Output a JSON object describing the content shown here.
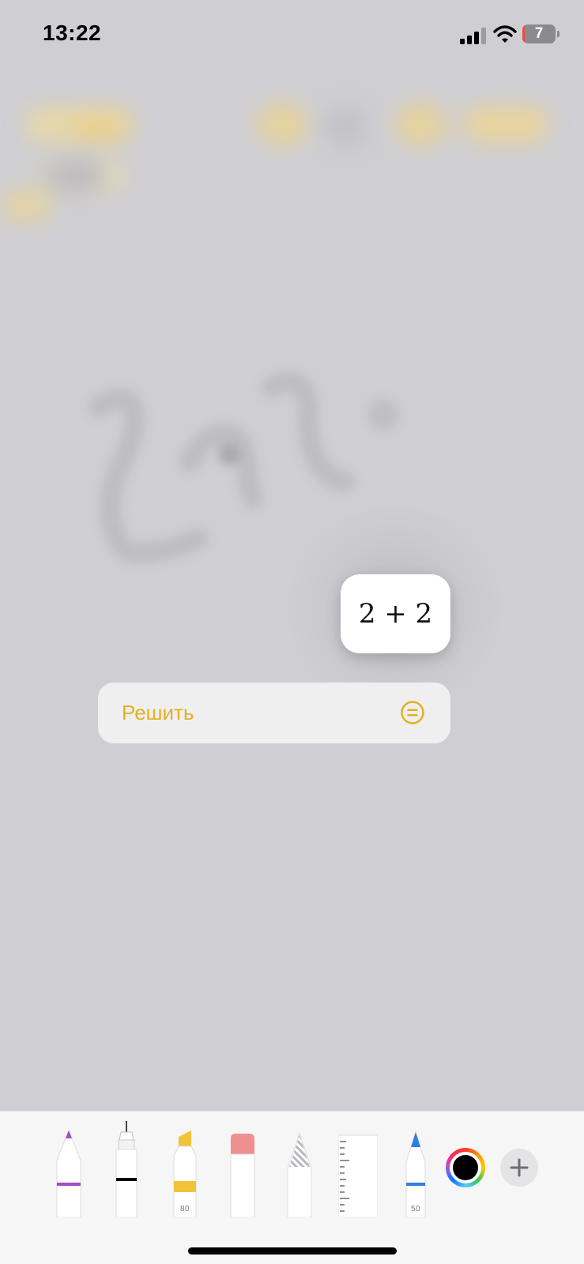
{
  "status_bar": {
    "time": "13:22",
    "battery_level": "7",
    "battery_fraction": 0.07,
    "signal_bars": 4,
    "signal_active": 3
  },
  "math": {
    "expression": "2 + 2"
  },
  "context_menu": {
    "solve_label": "Решить",
    "solve_icon": "equals-circle-icon",
    "accent_color": "#e2b123"
  },
  "toolbar": {
    "tools": [
      {
        "name": "pen-tool",
        "color": "#a64ac9",
        "label": ""
      },
      {
        "name": "monoline-tool",
        "color": "#000000",
        "label": ""
      },
      {
        "name": "highlighter-tool",
        "color": "#f0c43a",
        "label": "80"
      },
      {
        "name": "eraser-tool",
        "color": "#ef8f8f",
        "label": ""
      },
      {
        "name": "lasso-tool",
        "color": "#b9b9bd",
        "label": ""
      },
      {
        "name": "ruler-tool",
        "color": "#ffffff",
        "label": ""
      },
      {
        "name": "pencil-tool",
        "color": "#2f7ee8",
        "label": "50"
      }
    ],
    "selected_color": "#000000"
  }
}
